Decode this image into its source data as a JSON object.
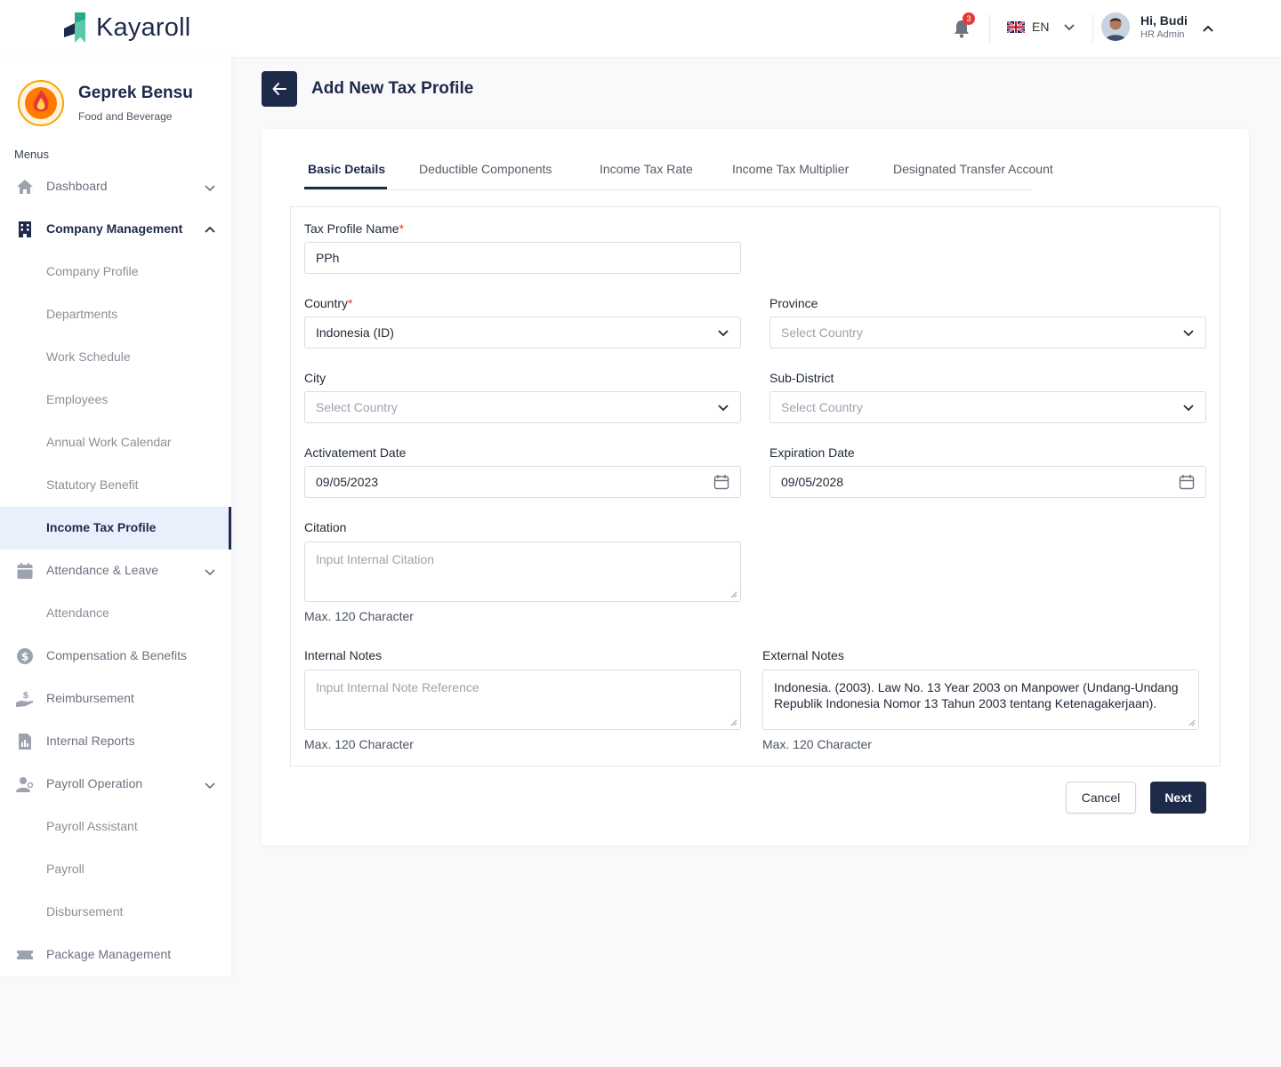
{
  "app": {
    "name": "Kayaroll"
  },
  "header": {
    "notifications_count": "3",
    "language": "EN",
    "greeting": "Hi, Budi",
    "role": "HR Admin"
  },
  "company": {
    "name": "Geprek Bensu",
    "category": "Food and Beverage"
  },
  "sidebar": {
    "menus_label": "Menus",
    "items": [
      {
        "label": "Dashboard"
      },
      {
        "label": "Company Management"
      },
      {
        "label": "Company Profile"
      },
      {
        "label": "Departments"
      },
      {
        "label": "Work Schedule"
      },
      {
        "label": "Employees"
      },
      {
        "label": "Annual Work Calendar"
      },
      {
        "label": "Statutory Benefit"
      },
      {
        "label": "Income Tax Profile"
      },
      {
        "label": "Attendance & Leave"
      },
      {
        "label": "Attendance"
      },
      {
        "label": "Compensation & Benefits"
      },
      {
        "label": "Reimbursement"
      },
      {
        "label": "Internal Reports"
      },
      {
        "label": "Payroll Operation"
      },
      {
        "label": "Payroll Assistant"
      },
      {
        "label": "Payroll"
      },
      {
        "label": "Disbursement"
      },
      {
        "label": "Package Management"
      }
    ]
  },
  "page": {
    "title": "Add New Tax Profile",
    "tabs": [
      {
        "label": "Basic Details"
      },
      {
        "label": "Deductible Components"
      },
      {
        "label": "Income Tax Rate"
      },
      {
        "label": "Income Tax Multiplier"
      },
      {
        "label": "Designated Transfer Account"
      }
    ]
  },
  "form": {
    "tax_profile_name": {
      "label": "Tax Profile Name",
      "required_mark": "*",
      "value": "PPh"
    },
    "country": {
      "label": "Country",
      "required_mark": "*",
      "value": "Indonesia (ID)"
    },
    "province": {
      "label": "Province",
      "placeholder": "Select Country"
    },
    "city": {
      "label": "City",
      "placeholder": "Select Country"
    },
    "sub_district": {
      "label": "Sub-District",
      "placeholder": "Select Country"
    },
    "activation_date": {
      "label": "Activatement Date",
      "value": "09/05/2023"
    },
    "expiration_date": {
      "label": "Expiration Date",
      "value": "09/05/2028"
    },
    "citation": {
      "label": "Citation",
      "placeholder": "Input Internal Citation",
      "hint": "Max. 120 Character"
    },
    "internal_notes": {
      "label": "Internal Notes",
      "placeholder": "Input Internal Note Reference",
      "hint": "Max. 120 Character"
    },
    "external_notes": {
      "label": "External Notes",
      "value": "Indonesia. (2003). Law No. 13 Year 2003 on Manpower (Undang-Undang Republik Indonesia Nomor 13 Tahun 2003 tentang Ketenagakerjaan).",
      "hint": "Max. 120 Character"
    }
  },
  "actions": {
    "cancel": "Cancel",
    "next": "Next"
  },
  "colors": {
    "primary": "#1e2a4a",
    "required": "#e53935",
    "active_bg": "#eaf0fb"
  }
}
